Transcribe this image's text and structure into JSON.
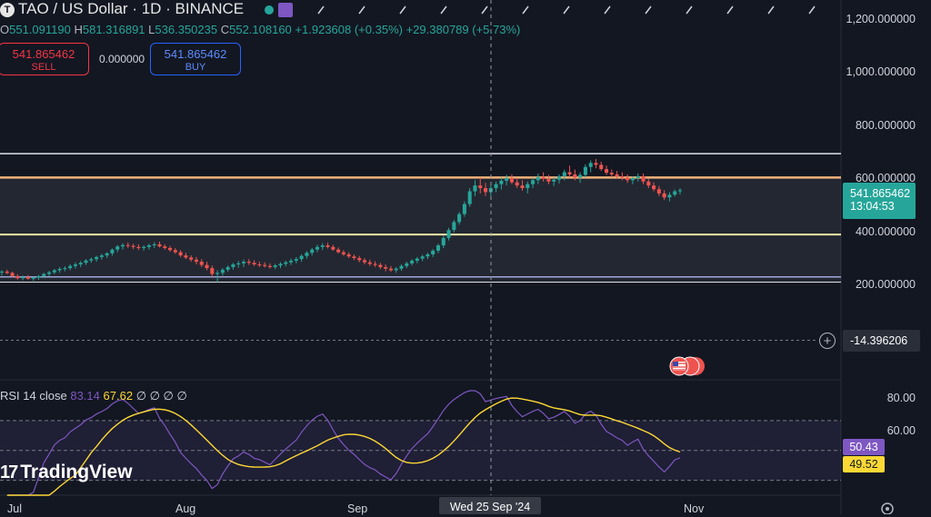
{
  "header": {
    "title": "TAO / US Dollar · 1D · BINANCE",
    "logo_glyph": "T",
    "ohlc": [
      {
        "k": "O",
        "v": "551.091190"
      },
      {
        "k": "H",
        "v": "581.316891"
      },
      {
        "k": "L",
        "v": "536.350235"
      },
      {
        "k": "C",
        "v": "552.108160"
      }
    ],
    "change": "+1.923608 (+0.35%)",
    "change2": "+29.380789 (+5.73%)"
  },
  "trade": {
    "sell_price": "541.865462",
    "sell_label": "SELL",
    "spread": "0.000000",
    "buy_price": "541.865462",
    "buy_label": "BUY"
  },
  "price_axis": {
    "labels": [
      "1,200.000000",
      "1,000.000000",
      "800.000000",
      "600.000000",
      "400.000000",
      "200.000000"
    ],
    "current_price": "541.865462",
    "countdown": "13:04:53",
    "crosshair_value": "-14.396206",
    "plus_glyph": "+"
  },
  "rsi": {
    "legend_name": "RSI",
    "legend_params": "14 close",
    "value1": "83.14",
    "value2": "67.62",
    "extras": "∅ ∅ ∅ ∅",
    "axis_labels": [
      "80.00",
      "60.00"
    ],
    "rsi_value": "50.43",
    "ma_value": "49.52"
  },
  "time_axis": {
    "labels": [
      "Jul",
      "Aug",
      "Sep",
      "Nov"
    ],
    "crosshair_date": "Wed 25 Sep '24"
  },
  "branding": {
    "mark": "17",
    "name": "TradingView"
  },
  "colors": {
    "up": "#26a69a",
    "down": "#ef5350",
    "rsi": "#7e57c2",
    "rsi_ma": "#fdd835",
    "hline_white": "#e0e3eb",
    "hline_orange": "#f0b27a",
    "hline_yellow": "#f5e6a8",
    "hline_blue": "#9fa8da"
  },
  "chart_data": {
    "type": "candlestick",
    "series": [
      {
        "ohlc": [
          [
            242,
            250,
            230,
            245
          ],
          [
            245,
            252,
            235,
            240
          ],
          [
            240,
            245,
            222,
            228
          ],
          [
            228,
            235,
            215,
            220
          ],
          [
            220,
            230,
            212,
            225
          ],
          [
            225,
            232,
            215,
            218
          ],
          [
            218,
            226,
            210,
            222
          ],
          [
            222,
            232,
            214,
            228
          ],
          [
            228,
            240,
            220,
            236
          ],
          [
            236,
            248,
            228,
            242
          ],
          [
            242,
            255,
            235,
            250
          ],
          [
            250,
            262,
            240,
            255
          ],
          [
            255,
            265,
            246,
            258
          ],
          [
            258,
            272,
            250,
            266
          ],
          [
            266,
            280,
            256,
            272
          ],
          [
            272,
            285,
            262,
            278
          ],
          [
            278,
            292,
            270,
            287
          ],
          [
            287,
            298,
            278,
            292
          ],
          [
            292,
            305,
            282,
            300
          ],
          [
            300,
            312,
            290,
            306
          ],
          [
            306,
            318,
            296,
            314
          ],
          [
            314,
            332,
            305,
            328
          ],
          [
            328,
            345,
            318,
            340
          ],
          [
            340,
            352,
            328,
            345
          ],
          [
            345,
            355,
            334,
            342
          ],
          [
            342,
            350,
            330,
            338
          ],
          [
            338,
            348,
            326,
            334
          ],
          [
            334,
            344,
            324,
            338
          ],
          [
            338,
            350,
            328,
            344
          ],
          [
            344,
            356,
            334,
            348
          ],
          [
            348,
            358,
            336,
            340
          ],
          [
            340,
            348,
            328,
            334
          ],
          [
            334,
            342,
            320,
            326
          ],
          [
            326,
            334,
            312,
            318
          ],
          [
            318,
            326,
            300,
            306
          ],
          [
            306,
            316,
            292,
            298
          ],
          [
            298,
            306,
            282,
            290
          ],
          [
            290,
            300,
            272,
            282
          ],
          [
            282,
            292,
            262,
            270
          ],
          [
            270,
            282,
            250,
            258
          ],
          [
            258,
            268,
            225,
            236
          ],
          [
            236,
            250,
            205,
            240
          ],
          [
            240,
            258,
            230,
            252
          ],
          [
            252,
            268,
            244,
            262
          ],
          [
            262,
            278,
            252,
            272
          ],
          [
            272,
            285,
            260,
            276
          ],
          [
            276,
            290,
            262,
            282
          ],
          [
            282,
            292,
            270,
            278
          ],
          [
            278,
            288,
            266,
            272
          ],
          [
            272,
            282,
            262,
            270
          ],
          [
            270,
            280,
            260,
            266
          ],
          [
            266,
            276,
            256,
            262
          ],
          [
            262,
            274,
            254,
            268
          ],
          [
            268,
            280,
            258,
            274
          ],
          [
            274,
            286,
            264,
            280
          ],
          [
            280,
            294,
            270,
            286
          ],
          [
            286,
            300,
            276,
            292
          ],
          [
            292,
            310,
            282,
            304
          ],
          [
            304,
            322,
            294,
            316
          ],
          [
            316,
            334,
            306,
            328
          ],
          [
            328,
            346,
            318,
            338
          ],
          [
            338,
            352,
            326,
            344
          ],
          [
            344,
            354,
            332,
            338
          ],
          [
            338,
            346,
            324,
            328
          ],
          [
            328,
            336,
            314,
            318
          ],
          [
            318,
            326,
            304,
            310
          ],
          [
            310,
            318,
            296,
            302
          ],
          [
            302,
            310,
            288,
            296
          ],
          [
            296,
            304,
            280,
            288
          ],
          [
            288,
            296,
            272,
            280
          ],
          [
            280,
            290,
            266,
            274
          ],
          [
            274,
            284,
            262,
            270
          ],
          [
            270,
            278,
            254,
            262
          ],
          [
            262,
            272,
            246,
            256
          ],
          [
            256,
            266,
            244,
            250
          ],
          [
            250,
            262,
            240,
            256
          ],
          [
            256,
            272,
            248,
            266
          ],
          [
            266,
            282,
            258,
            276
          ],
          [
            276,
            292,
            268,
            286
          ],
          [
            286,
            300,
            276,
            294
          ],
          [
            294,
            308,
            284,
            302
          ],
          [
            302,
            316,
            292,
            310
          ],
          [
            310,
            330,
            300,
            324
          ],
          [
            324,
            350,
            314,
            344
          ],
          [
            344,
            380,
            334,
            372
          ],
          [
            372,
            410,
            362,
            402
          ],
          [
            402,
            440,
            392,
            432
          ],
          [
            432,
            470,
            422,
            462
          ],
          [
            462,
            510,
            452,
            500
          ],
          [
            500,
            560,
            490,
            548
          ],
          [
            548,
            590,
            530,
            570
          ],
          [
            570,
            600,
            540,
            560
          ],
          [
            560,
            580,
            530,
            545
          ],
          [
            545,
            570,
            530,
            560
          ],
          [
            560,
            585,
            545,
            575
          ],
          [
            575,
            600,
            555,
            588
          ],
          [
            588,
            610,
            570,
            598
          ],
          [
            598,
            612,
            575,
            582
          ],
          [
            582,
            598,
            560,
            570
          ],
          [
            570,
            590,
            550,
            560
          ],
          [
            560,
            585,
            540,
            575
          ],
          [
            575,
            600,
            560,
            590
          ],
          [
            590,
            615,
            575,
            602
          ],
          [
            602,
            620,
            585,
            595
          ],
          [
            595,
            610,
            575,
            585
          ],
          [
            585,
            600,
            568,
            592
          ],
          [
            592,
            612,
            578,
            605
          ],
          [
            605,
            630,
            590,
            620
          ],
          [
            620,
            645,
            600,
            612
          ],
          [
            612,
            630,
            590,
            600
          ],
          [
            600,
            620,
            580,
            610
          ],
          [
            610,
            650,
            600,
            640
          ],
          [
            640,
            665,
            620,
            655
          ],
          [
            655,
            670,
            635,
            648
          ],
          [
            648,
            660,
            625,
            632
          ],
          [
            632,
            645,
            610,
            618
          ],
          [
            618,
            630,
            600,
            612
          ],
          [
            612,
            625,
            595,
            605
          ],
          [
            605,
            620,
            590,
            600
          ],
          [
            600,
            612,
            580,
            590
          ],
          [
            590,
            605,
            575,
            598
          ],
          [
            598,
            615,
            585,
            605
          ],
          [
            605,
            615,
            575,
            585
          ],
          [
            585,
            595,
            560,
            570
          ],
          [
            570,
            582,
            548,
            556
          ],
          [
            556,
            568,
            530,
            540
          ],
          [
            540,
            552,
            515,
            525
          ],
          [
            525,
            545,
            510,
            535
          ],
          [
            535,
            555,
            528,
            548
          ],
          [
            548,
            560,
            536,
            552
          ]
        ]
      }
    ],
    "horizontal_levels": [
      690,
      600,
      385,
      225,
      205
    ],
    "ylim": [
      100,
      1250
    ],
    "xlabels": [
      "Jul",
      "Aug",
      "Sep",
      "Nov"
    ],
    "rsi": {
      "ylim": [
        20,
        90
      ],
      "bands": [
        70,
        30
      ],
      "rsi_last": 50.43,
      "ma_last": 49.52
    }
  }
}
